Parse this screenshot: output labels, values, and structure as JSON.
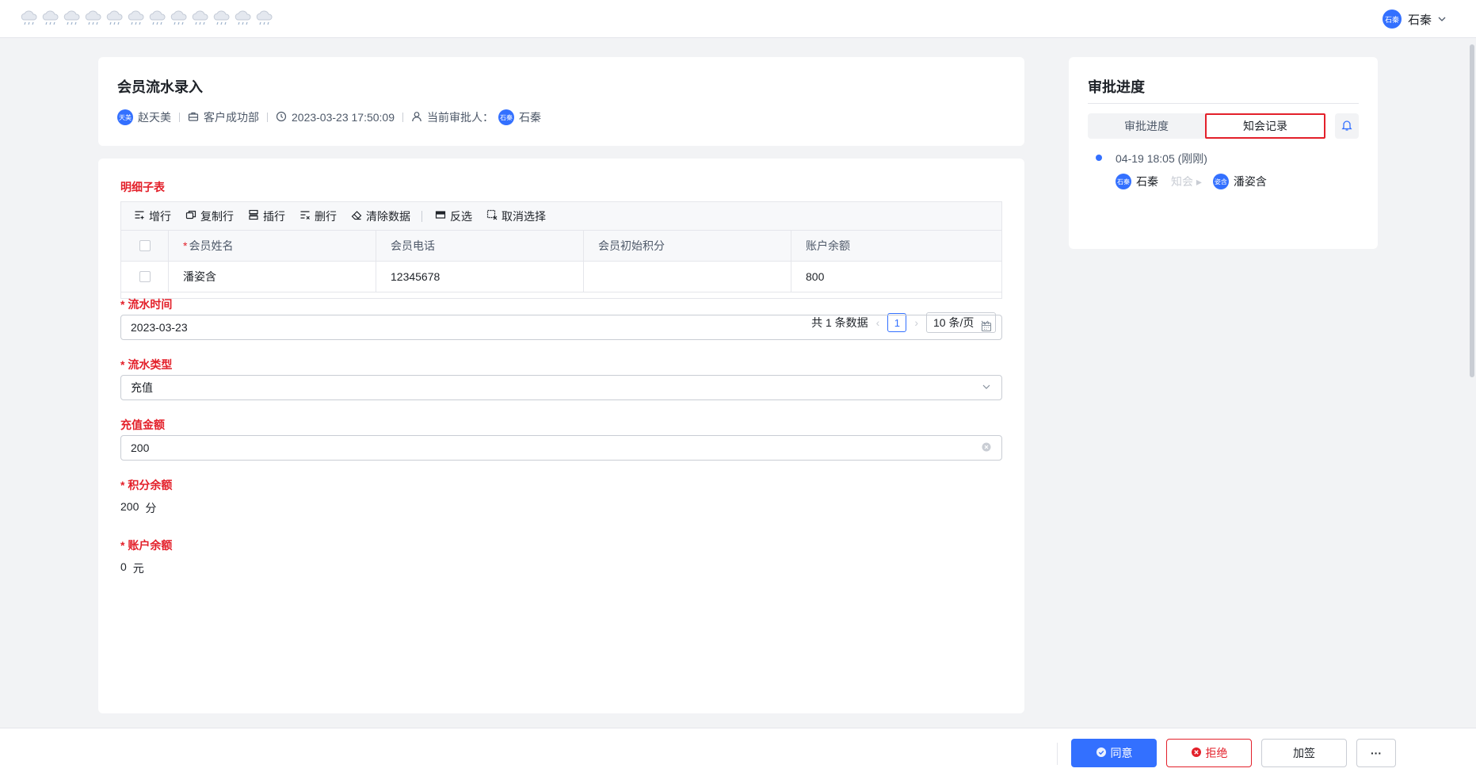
{
  "user": {
    "name": "石秦",
    "avatar_text": "石秦"
  },
  "header": {
    "title": "会员流水录入",
    "creator": "赵天美",
    "creator_avatar": "天美",
    "department": "客户成功部",
    "datetime": "2023-03-23 17:50:09",
    "approver_label": "当前审批人：",
    "approver": "石秦",
    "approver_avatar": "石秦"
  },
  "detail_table": {
    "section_title": "明细子表",
    "toolbar": {
      "add_row": "增行",
      "copy_row": "复制行",
      "insert_row": "插行",
      "delete_row": "删行",
      "clear_data": "清除数据",
      "invert_select": "反选",
      "cancel_select": "取消选择"
    },
    "columns": [
      "会员姓名",
      "会员电话",
      "会员初始积分",
      "账户余额"
    ],
    "rows": [
      {
        "name": "潘姿含",
        "phone": "12345678",
        "initial_points": "",
        "balance": "800"
      }
    ],
    "pagination": {
      "total_text": "共 1 条数据",
      "current_page": "1",
      "page_size": "10 条/页"
    }
  },
  "form": {
    "flow_time": {
      "label": "流水时间",
      "value": "2023-03-23"
    },
    "flow_type": {
      "label": "流水类型",
      "value": "充值"
    },
    "recharge_amount": {
      "label": "充值金额",
      "value": "200"
    },
    "points_balance": {
      "label": "积分余额",
      "value": "200",
      "unit": "分"
    },
    "account_balance": {
      "label": "账户余额",
      "value": "0",
      "unit": "元"
    }
  },
  "approval": {
    "title": "审批进度",
    "tabs": {
      "progress": "审批进度",
      "cc_record": "知会记录"
    },
    "timeline": {
      "time": "04-19 18:05 (刚刚)",
      "from_user": "石秦",
      "from_avatar": "石秦",
      "action": "知会",
      "to_user": "潘姿含",
      "to_avatar": "姿含"
    }
  },
  "actions": {
    "agree": "同意",
    "reject": "拒绝",
    "add_sign": "加签",
    "more": "···"
  },
  "colors": {
    "primary": "#3370ff",
    "danger": "#e3202a"
  }
}
